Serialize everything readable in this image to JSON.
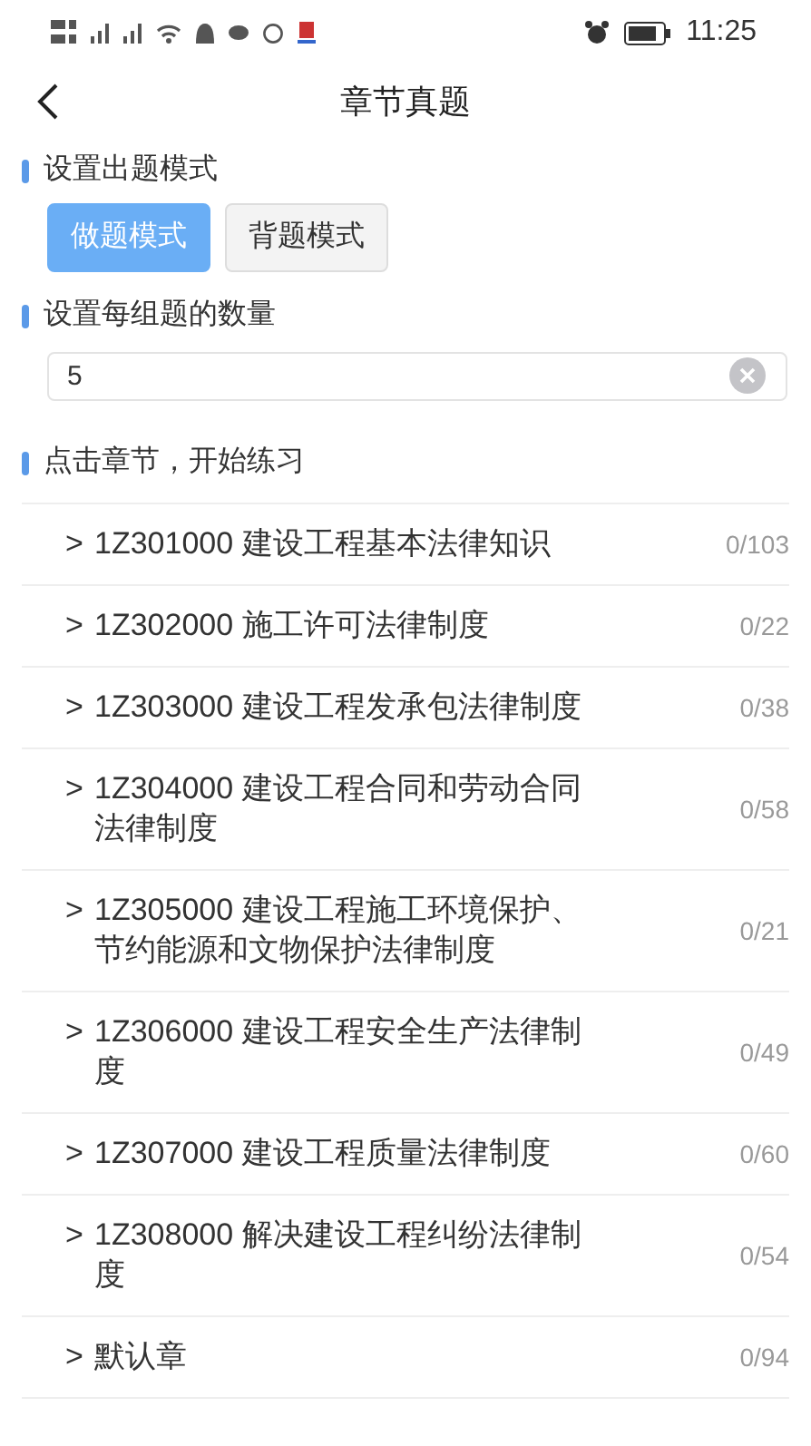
{
  "status_bar": {
    "time": "11:25"
  },
  "header": {
    "title": "章节真题"
  },
  "mode_section": {
    "heading": "设置出题模式",
    "modes": [
      {
        "label": "做题模式",
        "selected": true
      },
      {
        "label": "背题模式",
        "selected": false
      }
    ]
  },
  "count_section": {
    "heading": "设置每组题的数量",
    "value": "5"
  },
  "chapter_section": {
    "heading": "点击章节，开始练习",
    "chapters": [
      {
        "marker": ">",
        "title": "1Z301000 建设工程基本法律知识",
        "progress": "0/103"
      },
      {
        "marker": ">",
        "title": "1Z302000 施工许可法律制度",
        "progress": "0/22"
      },
      {
        "marker": ">",
        "title": "1Z303000 建设工程发承包法律制度",
        "progress": "0/38"
      },
      {
        "marker": ">",
        "title": "1Z304000 建设工程合同和劳动合同法律制度",
        "progress": "0/58"
      },
      {
        "marker": ">",
        "title": "1Z305000 建设工程施工环境保护、节约能源和文物保护法律制度",
        "progress": "0/21"
      },
      {
        "marker": ">",
        "title": "1Z306000 建设工程安全生产法律制度",
        "progress": "0/49"
      },
      {
        "marker": ">",
        "title": "1Z307000 建设工程质量法律制度",
        "progress": "0/60"
      },
      {
        "marker": ">",
        "title": "1Z308000 解决建设工程纠纷法律制度",
        "progress": "0/54"
      },
      {
        "marker": ">",
        "title": "默认章",
        "progress": "0/94"
      }
    ]
  }
}
